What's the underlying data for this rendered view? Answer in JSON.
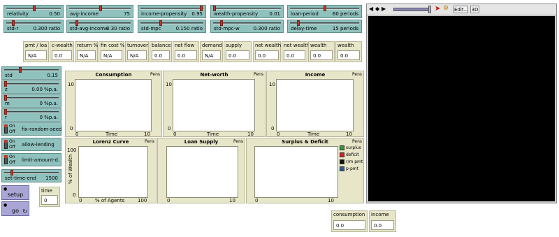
{
  "colors": {
    "slider": "#8fc1bd",
    "monitor": "#e8e6c8",
    "button": "#a9a6d6",
    "world": "#000000",
    "knob": "#c0392b"
  },
  "sliders_top": [
    {
      "label": "relativity",
      "value": "0.50",
      "fraction": 0.5
    },
    {
      "label": "avg-income",
      "value": "75",
      "fraction": 0.5
    },
    {
      "label": "income-propensity",
      "value": "0.95",
      "fraction": 0.95
    },
    {
      "label": "wealth-propensity",
      "value": "0.01",
      "fraction": 0.01
    },
    {
      "label": "loan-period",
      "value": "60 periods",
      "fraction": 0.5
    },
    {
      "label": "std-r",
      "value": "0.300 ratio",
      "fraction": 0.1
    },
    {
      "label": "std-avg-income",
      "value": "0.30 ratio",
      "fraction": 0.1
    },
    {
      "label": "std-mpc",
      "value": "0.150 ratio",
      "fraction": 0.05
    },
    {
      "label": "std-mpc-w",
      "value": "0.300 ratio",
      "fraction": 0.1
    },
    {
      "label": "delay-time",
      "value": "15 periods",
      "fraction": 0.1
    }
  ],
  "monitors_top": [
    {
      "label": "pmt / loa",
      "value": "N/A"
    },
    {
      "label": "c-wealth",
      "value": "0.0"
    },
    {
      "label": "return %",
      "value": "N/A"
    },
    {
      "label": "fin cost %",
      "value": "N/A"
    },
    {
      "label": "turnover",
      "value": "N/A"
    },
    {
      "label": "balance",
      "value": "0.0"
    },
    {
      "label": "net flow",
      "value": "0.0"
    },
    {
      "label": "demand",
      "value": "N/A"
    },
    {
      "label": "supply",
      "value": "0.0"
    },
    {
      "label": "net wealth",
      "value": "0.0"
    },
    {
      "label": "net wealth",
      "value": "0.0"
    },
    {
      "label": "wealth",
      "value": "0.0"
    },
    {
      "label": "wealth",
      "value": "0.0"
    }
  ],
  "sliders_left": [
    {
      "label": "std",
      "value": "0.15",
      "fraction": 0.15
    },
    {
      "label": "z",
      "value": "0.00 %p.a.",
      "fraction": 0.0
    },
    {
      "label": "m",
      "value": "0 %p.a.",
      "fraction": 0.0
    },
    {
      "label": "r",
      "value": "0 %p.a.",
      "fraction": 0.0
    }
  ],
  "switches": [
    {
      "label": "fix-random-seed",
      "on": "On",
      "off": "Off"
    },
    {
      "label": "allow-lending",
      "on": "On",
      "off": "Off"
    },
    {
      "label": "limit-amount-d.",
      "on": "On",
      "off": "Off"
    }
  ],
  "seed_slider": {
    "label": "set-time-end",
    "value": "1500",
    "fraction": 0.15
  },
  "buttons": {
    "setup": "setup",
    "go": "go"
  },
  "time_monitor": {
    "label": "time",
    "value": "0"
  },
  "plots": [
    {
      "title": "Consumption",
      "pens": "Pens",
      "ymax": "10",
      "ymin": "0",
      "xmin": "0",
      "xlabel": "Time",
      "xmax": "10"
    },
    {
      "title": "Net-worth",
      "pens": "Pens",
      "ymax": "10",
      "ymin": "0",
      "xmin": "0",
      "xlabel": "Time",
      "xmax": "10"
    },
    {
      "title": "Income",
      "pens": "Pens",
      "ymax": "10",
      "ymin": "0",
      "xmin": "0",
      "xlabel": "Time",
      "xmax": "10"
    },
    {
      "title": "Lorenz Curve",
      "pens": "Pens",
      "ymax": "100",
      "ymin": "0",
      "xmin": "0",
      "xlabel": "% of Agents",
      "xmax": "100",
      "ylabel": "% of Wealth"
    },
    {
      "title": "Loan Supply",
      "pens": "Pens",
      "ymax": "",
      "ymin": "",
      "xmin": "0",
      "xlabel": "",
      "xmax": "10"
    },
    {
      "title": "Surplus & Deficit",
      "pens": "Pens",
      "ymax": "",
      "ymin": "",
      "xmin": "0",
      "xlabel": "",
      "xmax": "10"
    }
  ],
  "legend": [
    {
      "name": "surplus",
      "color": "#2e9b3a"
    },
    {
      "name": "deficit",
      "color": "#d42020"
    },
    {
      "name": "r/m pmt",
      "color": "#111111"
    },
    {
      "name": "p-pmt",
      "color": "#2c5aa0"
    }
  ],
  "monitors_bottom": [
    {
      "label": "consumption",
      "value": "0.0"
    },
    {
      "label": "income",
      "value": "0.0"
    }
  ],
  "view_toolbar": {
    "edit": "Edit...",
    "three_d": "3D"
  }
}
